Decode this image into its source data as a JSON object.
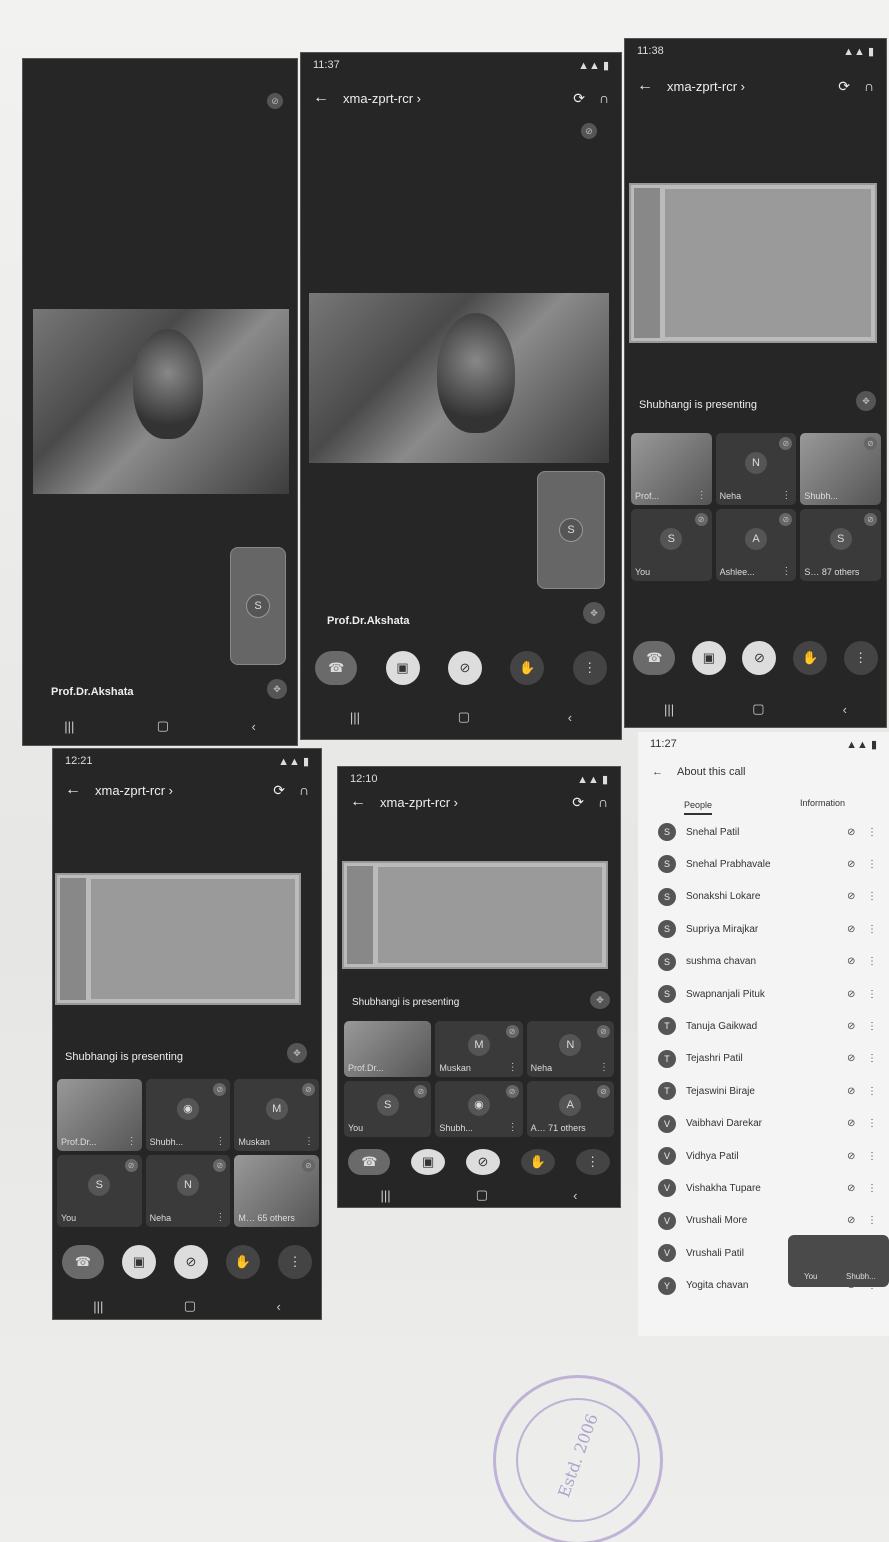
{
  "meeting_code": "xma-zprt-rcr ›",
  "shot1": {
    "name": "Prof.Dr.Akshata",
    "self_avatar": "S"
  },
  "shot2": {
    "time": "11:37",
    "name": "Prof.Dr.Akshata",
    "self_avatar": "S"
  },
  "shot3": {
    "time": "11:38",
    "presenting": "Shubhangi is presenting",
    "tiles": [
      {
        "name": "Prof...",
        "avatar": ""
      },
      {
        "name": "Neha",
        "avatar": "N"
      },
      {
        "name": "Shubh...",
        "avatar": ""
      },
      {
        "name": "You",
        "avatar": "S"
      },
      {
        "name": "Ashlee...",
        "avatar": "A"
      },
      {
        "name": "S… 87 others",
        "avatar": "S"
      }
    ]
  },
  "shot4": {
    "time": "12:21",
    "presenting": "Shubhangi is presenting",
    "tiles": [
      {
        "name": "Prof.Dr...",
        "avatar": ""
      },
      {
        "name": "Shubh...",
        "avatar": ""
      },
      {
        "name": "Muskan",
        "avatar": "M"
      },
      {
        "name": "You",
        "avatar": "S"
      },
      {
        "name": "Neha",
        "avatar": "N"
      },
      {
        "name": "M… 65 others",
        "avatar": ""
      }
    ]
  },
  "shot5": {
    "time": "12:10",
    "presenting": "Shubhangi is presenting",
    "tiles": [
      {
        "name": "Prof.Dr...",
        "avatar": ""
      },
      {
        "name": "Muskan",
        "avatar": "M"
      },
      {
        "name": "Neha",
        "avatar": "N"
      },
      {
        "name": "You",
        "avatar": "S"
      },
      {
        "name": "Shubh...",
        "avatar": ""
      },
      {
        "name": "A… 71 others",
        "avatar": "A"
      }
    ]
  },
  "shot6": {
    "time": "11:27",
    "header": "About this call",
    "tab_people": "People",
    "tab_info": "Information",
    "people": [
      {
        "initial": "S",
        "name": "Snehal Patil"
      },
      {
        "initial": "S",
        "name": "Snehal Prabhavale"
      },
      {
        "initial": "S",
        "name": "Sonakshi Lokare"
      },
      {
        "initial": "S",
        "name": "Supriya Mirajkar"
      },
      {
        "initial": "S",
        "name": "sushma chavan"
      },
      {
        "initial": "S",
        "name": "Swapnanjali Pituk"
      },
      {
        "initial": "T",
        "name": "Tanuja Gaikwad"
      },
      {
        "initial": "T",
        "name": "Tejashri Patil"
      },
      {
        "initial": "T",
        "name": "Tejaswini Biraje"
      },
      {
        "initial": "V",
        "name": "Vaibhavi Darekar"
      },
      {
        "initial": "V",
        "name": "Vidhya Patil"
      },
      {
        "initial": "V",
        "name": "Vishakha Tupare"
      },
      {
        "initial": "V",
        "name": "Vrushali More"
      },
      {
        "initial": "V",
        "name": "Vrushali Patil"
      },
      {
        "initial": "Y",
        "name": "Yogita chavan"
      }
    ],
    "mini_you": "You",
    "mini_other": "Shubh..."
  },
  "stamp_text": "Estd. 2006",
  "icons": {
    "back": "←",
    "flip": "⟳",
    "audio": "∩",
    "end_call": "☎",
    "cam_off": "▣",
    "mic_off": "⊘",
    "hand": "✋",
    "more": "⋮",
    "nav_recent": "|||",
    "nav_home": "▢",
    "nav_back": "‹"
  }
}
